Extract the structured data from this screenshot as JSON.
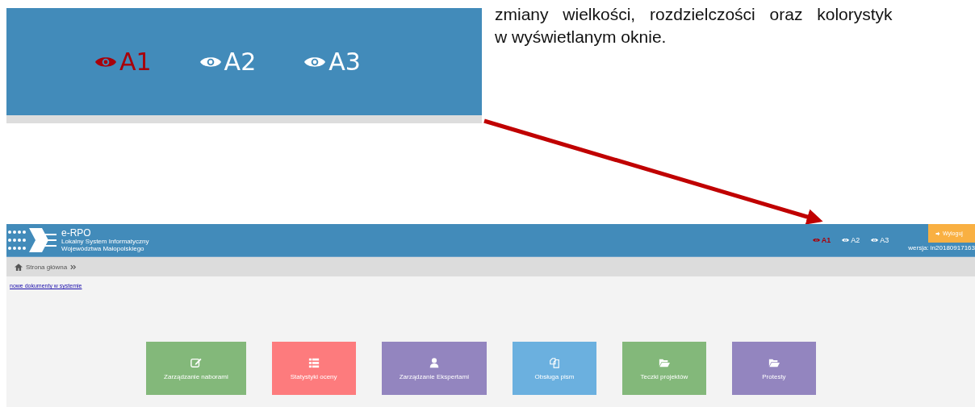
{
  "document": {
    "text_lines": [
      "zmiany wielkości, rozdzielczości oraz kolorystyk",
      "w wyświetlanym oknie."
    ]
  },
  "zoom_inset": {
    "font_options": [
      {
        "label": "A1",
        "selected": true
      },
      {
        "label": "A2",
        "selected": false
      },
      {
        "label": "A3",
        "selected": false
      }
    ]
  },
  "app": {
    "logo": {
      "title": "e-RPO",
      "subtitle_lines": [
        "Lokalny System Informatyczny",
        "Województwa Małopolskiego"
      ]
    },
    "font_options": [
      {
        "label": "A1",
        "selected": true
      },
      {
        "label": "A2",
        "selected": false
      },
      {
        "label": "A3",
        "selected": false
      }
    ],
    "logout_button": "Wyloguj",
    "version": "wersja: in20180917163",
    "breadcrumb": "Strona główna",
    "link": "nowe dokumenty w systemie",
    "tiles": [
      {
        "label": "Zarządzanie naborami",
        "kind": "edit",
        "color": "#83b87a"
      },
      {
        "label": "Statystyki oceny",
        "kind": "list",
        "color": "#fd7b7d"
      },
      {
        "label": "Zarządzanie Ekspertami",
        "kind": "user",
        "color": "#9385bf"
      },
      {
        "label": "Obsługa pism",
        "kind": "copy",
        "color": "#6bb0df"
      },
      {
        "label": "Teczki projektów",
        "kind": "folder",
        "color": "#83b87a"
      },
      {
        "label": "Protesty",
        "kind": "folder",
        "color": "#9385bf"
      }
    ]
  }
}
